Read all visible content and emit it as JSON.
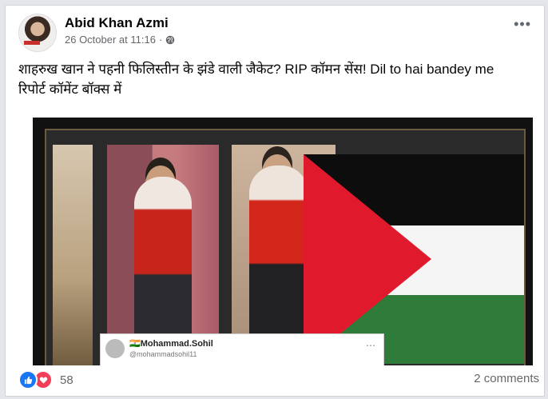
{
  "post": {
    "author_name": "Abid Khan Azmi",
    "timestamp": "26 October at 11:16",
    "visibility_separator": "·",
    "audience_icon": "globe-icon",
    "more_icon": "more-options-icon",
    "text_line1": "शाहरुख खान ने पहनी फिलिस्तीन के झंडे वाली जैकेट? RIP कॉमन सेंस! Dil to hai bandey me",
    "text_line2": "रिपोर्ट कॉमेंट बॉक्स में"
  },
  "image_comment_overlay": {
    "name": "🇮🇳Mohammad.Sohil",
    "handle": "@mohammadsohil11",
    "dots": "⋯"
  },
  "footer": {
    "reactions_count": "58",
    "reaction_icons": [
      "like-icon",
      "love-icon"
    ],
    "comments_label": "2 comments"
  },
  "colors": {
    "facebook_blue": "#1877f2",
    "love_red": "#f33e58",
    "secondary_text": "#65676b"
  }
}
